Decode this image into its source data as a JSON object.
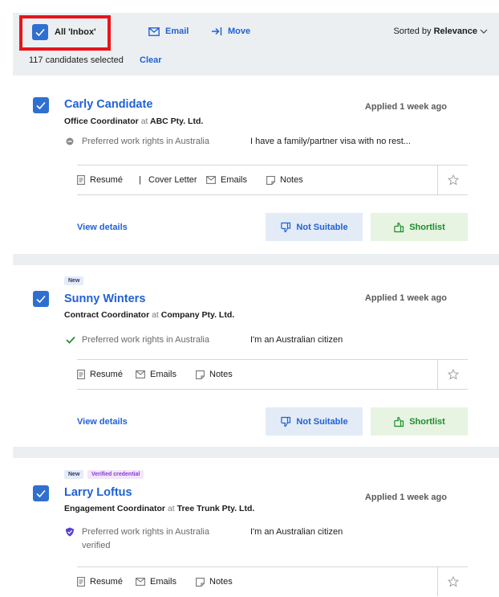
{
  "toolbar": {
    "select_all_label": "All 'Inbox'",
    "email_label": "Email",
    "move_label": "Move",
    "sort_prefix": "Sorted by",
    "sort_value": "Relevance",
    "selected_text": "117 candidates selected",
    "clear_label": "Clear"
  },
  "candidates": [
    {
      "name": "Carly Candidate",
      "role": "Office Coordinator",
      "at": "at",
      "company": "ABC Pty. Ltd.",
      "applied": "Applied 1 week ago",
      "work_rights_label": "Preferred work rights in Australia",
      "work_rights_value": "I have a family/partner visa with no rest...",
      "resume": "Resumé",
      "pipe": "|",
      "cover_letter": "Cover Letter",
      "emails": "Emails",
      "notes": "Notes",
      "view_details": "View details",
      "not_suitable": "Not Suitable",
      "shortlist": "Shortlist"
    },
    {
      "badge_new": "New",
      "name": "Sunny Winters",
      "role": "Contract Coordinator",
      "at": "at",
      "company": "Company Pty. Ltd.",
      "applied": "Applied 1 week ago",
      "work_rights_label": "Preferred work rights in Australia",
      "work_rights_value": "I'm an Australian citizen",
      "resume": "Resumé",
      "emails": "Emails",
      "notes": "Notes",
      "view_details": "View details",
      "not_suitable": "Not Suitable",
      "shortlist": "Shortlist"
    },
    {
      "badge_new": "New",
      "badge_verified": "Verified credential",
      "name": "Larry Loftus",
      "role": "Engagement Coordinator",
      "at": "at",
      "company": "Tree Trunk Pty. Ltd.",
      "applied": "Applied 1 week ago",
      "work_rights_label": "Preferred work rights in Australia",
      "work_rights_sub": "verified",
      "work_rights_value": "I'm an Australian citizen",
      "resume": "Resumé",
      "emails": "Emails",
      "notes": "Notes"
    }
  ],
  "colors": {
    "accent": "#2062d5",
    "checkbox": "#2f6fd0",
    "highlight": "#e8141b",
    "shortlist_green": "#1e8d2e"
  }
}
